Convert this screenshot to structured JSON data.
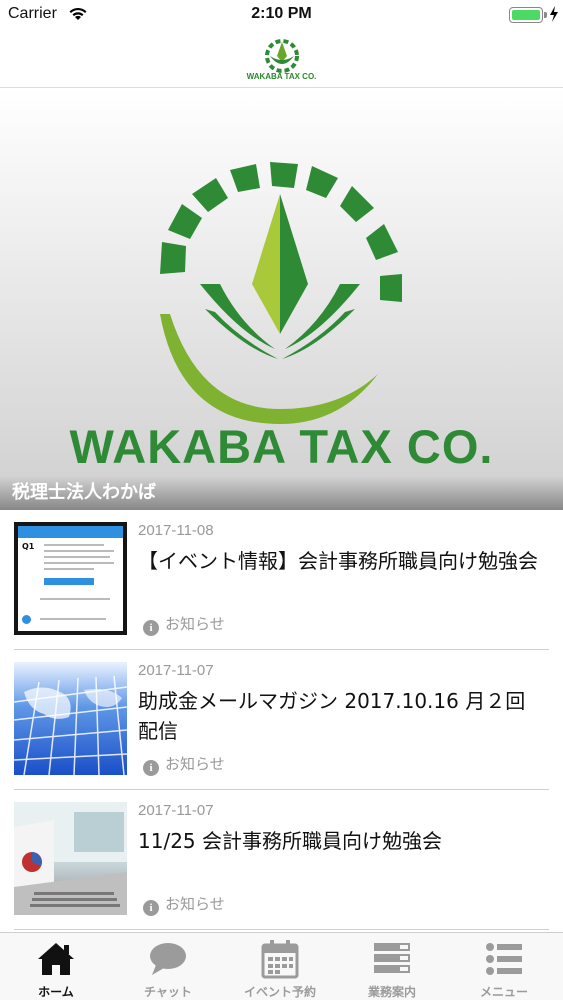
{
  "status_bar": {
    "carrier": "Carrier",
    "time": "2:10 PM",
    "battery_color": "#4cd964",
    "battery_level": 1.0
  },
  "header": {
    "logo_text": "WAKABA TAX CO."
  },
  "hero": {
    "brand_text": "WAKABA TAX CO.",
    "caption": "税理士法人わかば"
  },
  "news": [
    {
      "date": "2017-11-08",
      "title": "【イベント情報】会計事務所職員向け勉強会",
      "category": "お知らせ",
      "thumbnail": "reservation-form-screenshot"
    },
    {
      "date": "2017-11-07",
      "title": "助成金メールマガジン 2017.10.16 月２回配信",
      "category": "お知らせ",
      "thumbnail": "world-map-grid-image"
    },
    {
      "date": "2017-11-07",
      "title": "11/25 会計事務所職員向け勉強会",
      "category": "お知らせ",
      "thumbnail": "laptop-image"
    }
  ],
  "tabs": [
    {
      "label": "ホーム",
      "icon": "home-icon",
      "active": true
    },
    {
      "label": "チャット",
      "icon": "chat-bubble-icon",
      "active": false
    },
    {
      "label": "イベント予約",
      "icon": "calendar-icon",
      "active": false
    },
    {
      "label": "業務案内",
      "icon": "stacked-bars-icon",
      "active": false
    },
    {
      "label": "メニュー",
      "icon": "list-icon",
      "active": false
    }
  ],
  "colors": {
    "brand_green": "#2f8a36",
    "light_green": "#8bbf2e",
    "tab_active": "#111111",
    "tab_inactive": "#9b9b9b"
  }
}
